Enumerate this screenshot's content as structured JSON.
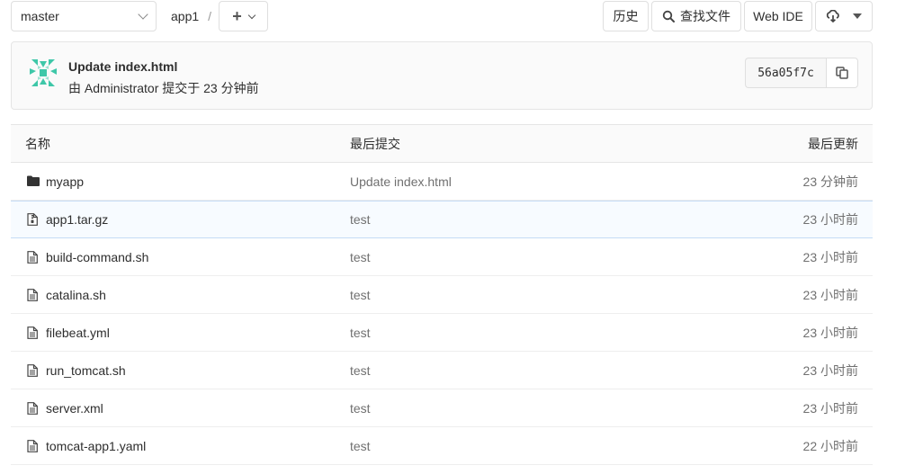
{
  "toolbar": {
    "branch": "master",
    "breadcrumb_repo": "app1",
    "breadcrumb_sep": "/",
    "history_label": "历史",
    "find_file_label": "查找文件",
    "web_ide_label": "Web IDE"
  },
  "commit": {
    "title": "Update index.html",
    "meta": "由 Administrator 提交于 23 分钟前",
    "sha": "56a05f7c"
  },
  "table": {
    "headers": {
      "name": "名称",
      "last_commit": "最后提交",
      "last_update": "最后更新"
    },
    "rows": [
      {
        "type": "folder",
        "name": "myapp",
        "commit": "Update index.html",
        "date": "23 分钟前"
      },
      {
        "type": "archive",
        "name": "app1.tar.gz",
        "commit": "test",
        "date": "23 小时前"
      },
      {
        "type": "file",
        "name": "build-command.sh",
        "commit": "test",
        "date": "23 小时前"
      },
      {
        "type": "file",
        "name": "catalina.sh",
        "commit": "test",
        "date": "23 小时前"
      },
      {
        "type": "file",
        "name": "filebeat.yml",
        "commit": "test",
        "date": "23 小时前"
      },
      {
        "type": "file",
        "name": "run_tomcat.sh",
        "commit": "test",
        "date": "23 小时前"
      },
      {
        "type": "file",
        "name": "server.xml",
        "commit": "test",
        "date": "23 小时前"
      },
      {
        "type": "file",
        "name": "tomcat-app1.yaml",
        "commit": "test",
        "date": "22 小时前"
      }
    ]
  },
  "icons": {
    "search": "search-icon",
    "clone": "cloud-download-icon",
    "copy": "copy-icon",
    "folder": "folder-icon",
    "file": "file-icon",
    "archive": "archive-file-icon"
  },
  "colors": {
    "avatar_teal": "#3ec7a8",
    "highlight_border": "#c5dbf5"
  }
}
